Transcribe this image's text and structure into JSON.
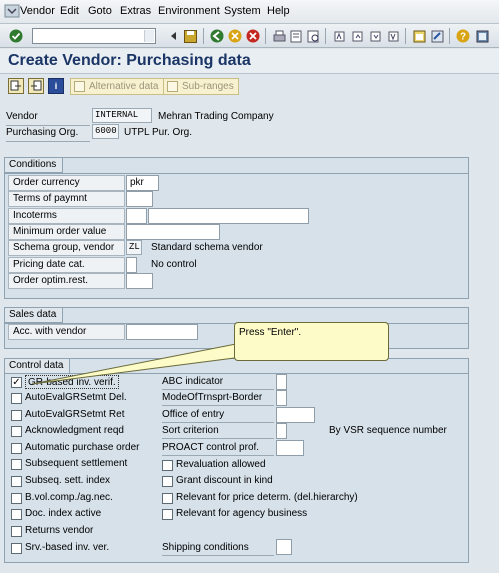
{
  "menu": {
    "items": [
      {
        "label": "Vendor"
      },
      {
        "label": "Edit"
      },
      {
        "label": "Goto"
      },
      {
        "label": "Extras"
      },
      {
        "label": "Environment"
      },
      {
        "label": "System"
      },
      {
        "label": "Help"
      }
    ]
  },
  "toolbar": {
    "command_value": ""
  },
  "title": "Create Vendor: Purchasing data",
  "app_toolbar": {
    "alt_data_label": "Alternative data",
    "sub_ranges_label": "Sub-ranges"
  },
  "header": {
    "vendor_label": "Vendor",
    "vendor_value": "INTERNAL",
    "vendor_name": "Mehran Trading Company",
    "porg_label": "Purchasing Org.",
    "porg_value": "6000",
    "porg_name": "UTPL Pur. Org."
  },
  "conditions": {
    "title": "Conditions",
    "order_currency_label": "Order currency",
    "order_currency_value": "pkr",
    "terms_label": "Terms of paymnt",
    "incoterms_label": "Incoterms",
    "min_order_label": "Minimum order value",
    "schema_label": "Schema group, vendor",
    "schema_value": "ZL",
    "schema_desc": "Standard schema vendor",
    "pricing_label": "Pricing date cat.",
    "pricing_desc": "No control",
    "order_optim_label": "Order optim.rest."
  },
  "sales": {
    "title": "Sales data",
    "acc_label": "Acc. with vendor"
  },
  "tooltip": {
    "text": "Press \"Enter\"."
  },
  "control": {
    "title": "Control data",
    "left": [
      {
        "label": "GR-based inv. verif.",
        "checked": true
      },
      {
        "label": "AutoEvalGRSetmt Del.",
        "checked": false
      },
      {
        "label": "AutoEvalGRSetmt Ret",
        "checked": false
      },
      {
        "label": "Acknowledgment reqd",
        "checked": false
      },
      {
        "label": "Automatic purchase order",
        "checked": false
      },
      {
        "label": "Subsequent settlement",
        "checked": false
      },
      {
        "label": "Subseq. sett. index",
        "checked": false
      },
      {
        "label": "B.vol.comp./ag.nec.",
        "checked": false
      },
      {
        "label": "Doc. index active",
        "checked": false
      },
      {
        "label": "Returns vendor",
        "checked": false
      },
      {
        "label": "Srv.-based inv. ver.",
        "checked": false
      }
    ],
    "abc_label": "ABC indicator",
    "mode_label": "ModeOfTrnsprt-Border",
    "office_label": "Office of entry",
    "sort_label": "Sort criterion",
    "sort_desc": "By VSR sequence number",
    "proact_label": "PROACT control prof.",
    "right_checks": [
      {
        "label": "Revaluation allowed",
        "checked": false
      },
      {
        "label": "Grant discount in kind",
        "checked": false
      },
      {
        "label": "Relevant for price determ. (del.hierarchy)",
        "checked": false
      },
      {
        "label": "Relevant for agency business",
        "checked": false
      }
    ],
    "shipping_label": "Shipping conditions"
  }
}
